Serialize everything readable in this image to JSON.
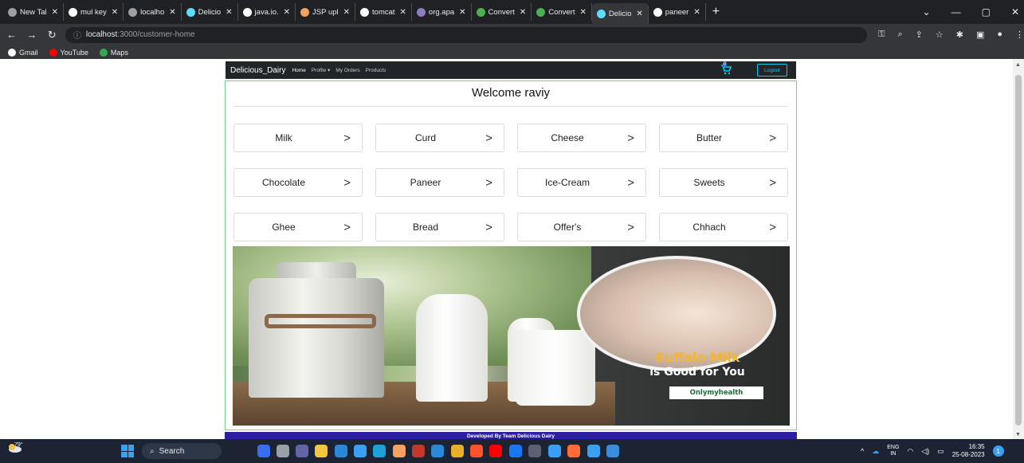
{
  "browser": {
    "tabs": [
      {
        "label": "New Tal",
        "color": "#9aa0a6",
        "active": false
      },
      {
        "label": "mul key",
        "color": "#ffffff",
        "active": false
      },
      {
        "label": "localho",
        "color": "#9aa0a6",
        "active": false
      },
      {
        "label": "Delicio",
        "color": "#61dafb",
        "active": false
      },
      {
        "label": "java.io.",
        "color": "#ffffff",
        "active": false
      },
      {
        "label": "JSP upl",
        "color": "#f4a261",
        "active": false
      },
      {
        "label": "tomcat",
        "color": "#ffffff",
        "active": false
      },
      {
        "label": "org.apa",
        "color": "#8e7cc3",
        "active": false
      },
      {
        "label": "Convert",
        "color": "#4caf50",
        "active": false
      },
      {
        "label": "Convert",
        "color": "#4caf50",
        "active": false
      },
      {
        "label": "Delicio",
        "color": "#61dafb",
        "active": true
      },
      {
        "label": "paneer",
        "color": "#ffffff",
        "active": false
      }
    ],
    "url_host": "localhost",
    "url_path": ":3000/customer-home",
    "bookmarks": [
      {
        "label": "Gmail",
        "color": "#ffffff"
      },
      {
        "label": "YouTube",
        "color": "#ff0000"
      },
      {
        "label": "Maps",
        "color": "#34a853"
      }
    ]
  },
  "app": {
    "brand": "Delicious_Dairy",
    "nav": {
      "home": "Home",
      "profile": "Profile ▾",
      "orders": "My Orders",
      "products": "Products"
    },
    "cart_count": "0",
    "logout": "Logout",
    "welcome": "Welcome raviy",
    "categories": [
      "Milk",
      "Curd",
      "Cheese",
      "Butter",
      "Chocolate",
      "Paneer",
      "Ice-Cream",
      "Sweets",
      "Ghee",
      "Bread",
      "Offer's",
      "Chhach"
    ],
    "banner": {
      "title": "Buffalo Milk",
      "subtitle": "is Good for You",
      "brand": "Onlymyhealth"
    },
    "footer": "Developed By Team Delicious Dairy"
  },
  "taskbar": {
    "temperature": "79°",
    "search": "Search",
    "lang_top": "ENG",
    "lang_bottom": "IN",
    "time": "16:35",
    "date": "25-08-2023",
    "notifications": "1"
  }
}
